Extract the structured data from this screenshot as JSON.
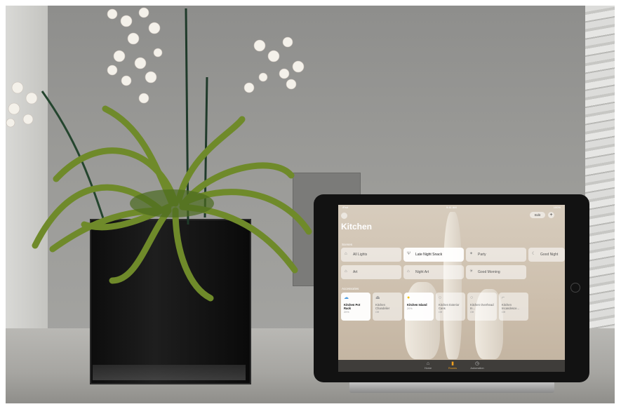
{
  "home_app": {
    "status_bar": {
      "carrier": "iPad",
      "time": "9:41 AM",
      "battery": "100%"
    },
    "edit_label": "Edit",
    "add_label": "+",
    "room_title": "Kitchen",
    "scenes_header": "Scenes",
    "accessories_header": "Accessories",
    "scenes": [
      {
        "label": "All Lights",
        "icon": "house-icon",
        "active": false
      },
      {
        "label": "Late Night Snack",
        "icon": "utensils-icon",
        "active": true
      },
      {
        "label": "Party",
        "icon": "party-icon",
        "active": false
      },
      {
        "label": "Good Night",
        "icon": "moon-icon",
        "active": false
      },
      {
        "label": "Art",
        "icon": "house-icon",
        "active": false
      },
      {
        "label": "Night Art",
        "icon": "house-icon",
        "active": false
      },
      {
        "label": "Good Morning",
        "icon": "sun-icon",
        "active": false
      }
    ],
    "accessories": [
      {
        "name": "Kitchen Pot Rack",
        "state": "20%",
        "icon": "cloud-light-icon",
        "active": true
      },
      {
        "name": "Kitchen Chandelier",
        "state": "Off",
        "icon": "pendant-lamp-icon",
        "active": false
      },
      {
        "name": "Kitchen Island",
        "state": "20%",
        "icon": "bulb-icon",
        "active": true
      },
      {
        "name": "Kitchen Exterior Cans",
        "state": "Off",
        "icon": "bulb-icon",
        "active": false
      },
      {
        "name": "Kitchen Overhead In...",
        "state": "Off",
        "icon": "bulb-icon",
        "active": false
      },
      {
        "name": "Kitchen Incandesce...",
        "state": "Off",
        "icon": "desk-lamp-icon",
        "active": false
      }
    ],
    "tabs": [
      {
        "label": "Home",
        "icon": "home-tab-icon",
        "active": false
      },
      {
        "label": "Rooms",
        "icon": "rooms-tab-icon",
        "active": true
      },
      {
        "label": "Automation",
        "icon": "automation-tab-icon",
        "active": false
      }
    ]
  }
}
